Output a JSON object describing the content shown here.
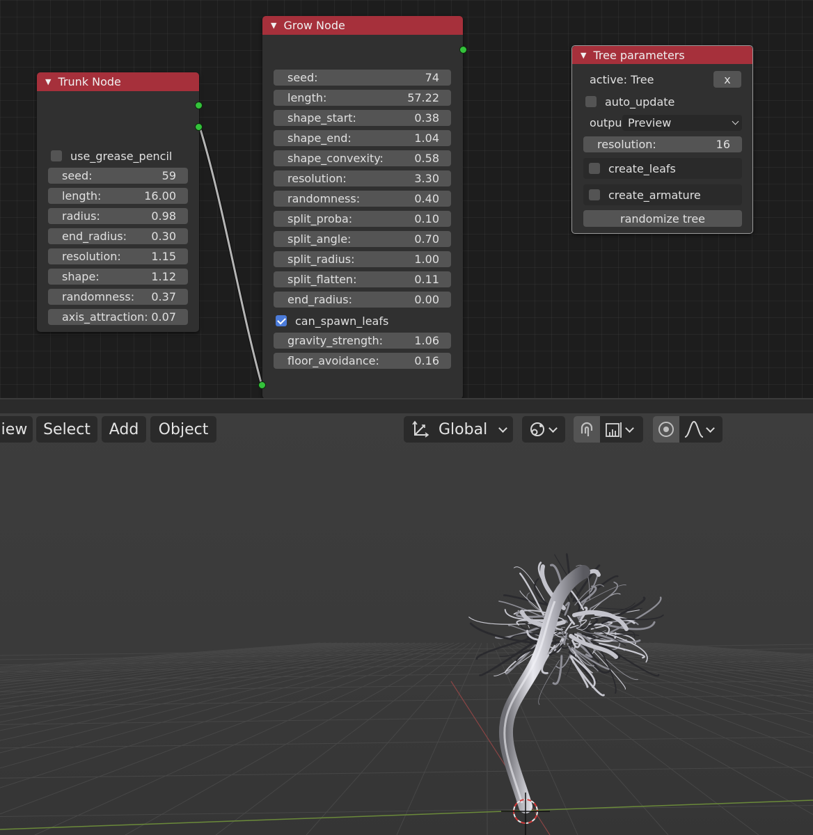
{
  "trunk_node": {
    "title": "Trunk Node",
    "use_grease_pencil": {
      "label": "use_grease_pencil",
      "checked": false
    },
    "fields": [
      {
        "label": "seed:",
        "value": "59"
      },
      {
        "label": "length:",
        "value": "16.00"
      },
      {
        "label": "radius:",
        "value": "0.98"
      },
      {
        "label": "end_radius:",
        "value": "0.30"
      },
      {
        "label": "resolution:",
        "value": "1.15"
      },
      {
        "label": "shape:",
        "value": "1.12"
      },
      {
        "label": "randomness:",
        "value": "0.37"
      },
      {
        "label": "axis_attraction:",
        "value": "0.07"
      }
    ]
  },
  "grow_node": {
    "title": "Grow Node",
    "fields_a": [
      {
        "label": "seed:",
        "value": "74"
      },
      {
        "label": "length:",
        "value": "57.22"
      },
      {
        "label": "shape_start:",
        "value": "0.38"
      },
      {
        "label": "shape_end:",
        "value": "1.04"
      },
      {
        "label": "shape_convexity:",
        "value": "0.58"
      },
      {
        "label": "resolution:",
        "value": "3.30"
      },
      {
        "label": "randomness:",
        "value": "0.40"
      },
      {
        "label": "split_proba:",
        "value": "0.10"
      },
      {
        "label": "split_angle:",
        "value": "0.70"
      },
      {
        "label": "split_radius:",
        "value": "1.00"
      },
      {
        "label": "split_flatten:",
        "value": "0.11"
      },
      {
        "label": "end_radius:",
        "value": "0.00"
      }
    ],
    "can_spawn_leafs": {
      "label": "can_spawn_leafs",
      "checked": true
    },
    "fields_b": [
      {
        "label": "gravity_strength:",
        "value": "1.06"
      },
      {
        "label": "floor_avoidance:",
        "value": "0.16"
      }
    ]
  },
  "tree_parameters": {
    "title": "Tree parameters",
    "active_label": "active: Tree",
    "clear_label": "x",
    "auto_update": {
      "label": "auto_update",
      "checked": false
    },
    "output_label": "outpu",
    "output_value": "Preview",
    "resolution": {
      "label": "resolution:",
      "value": "16"
    },
    "create_leafs": {
      "label": "create_leafs",
      "checked": false
    },
    "create_armature": {
      "label": "create_armature",
      "checked": false
    },
    "randomize_label": "randomize tree"
  },
  "viewport_header": {
    "menus": [
      "iew",
      "Select",
      "Add",
      "Object"
    ],
    "orientation": "Global"
  },
  "colors": {
    "node_header": "#a6303b",
    "socket": "#34c23b",
    "checkbox_checked": "#4b7bd9"
  }
}
